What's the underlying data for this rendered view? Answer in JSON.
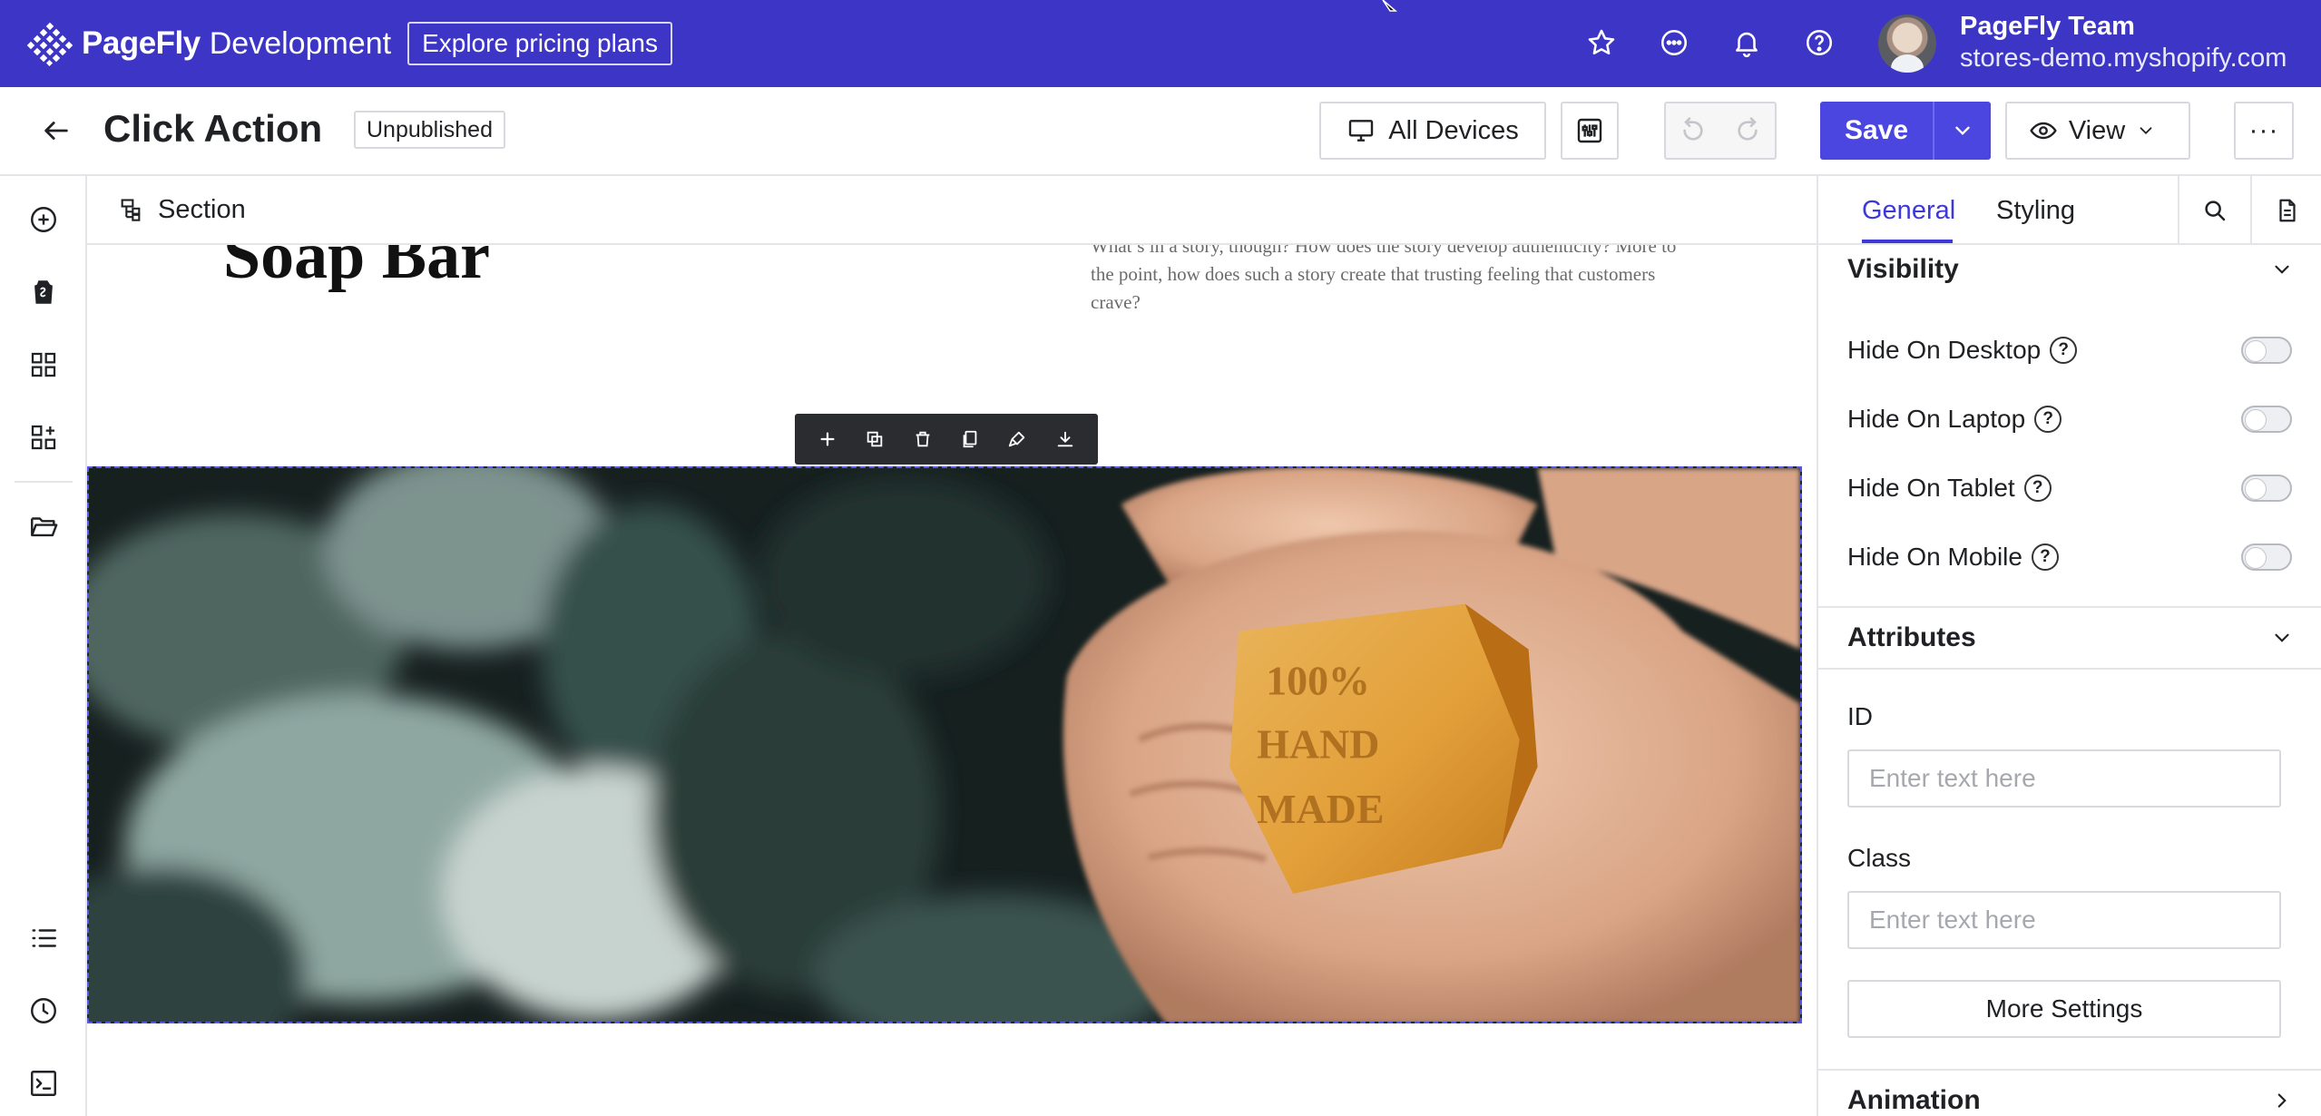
{
  "app": {
    "brand_name": "PageFly",
    "environment": "Development",
    "pricing_link": "Explore pricing plans",
    "team_name": "PageFly Team",
    "store_url": "stores-demo.myshopify.com"
  },
  "toolbar": {
    "page_title": "Click Action",
    "status": "Unpublished",
    "devices_label": "All Devices",
    "save_label": "Save",
    "view_label": "View",
    "more_label": "···"
  },
  "canvas": {
    "breadcrumb": "Section",
    "hero_title": "Soap Bar",
    "hero_copy": "What’s in a story, though? How does the story develop authenticity? More to the point, how does such a story create that trusting feeling that customers crave?",
    "soap_text": "100% HAND MADE"
  },
  "panel": {
    "tabs": [
      {
        "label": "General",
        "active": true
      },
      {
        "label": "Styling",
        "active": false
      }
    ],
    "visibility": {
      "title": "Visibility",
      "items": [
        {
          "label": "Hide On Desktop",
          "enabled": false
        },
        {
          "label": "Hide On Laptop",
          "enabled": false
        },
        {
          "label": "Hide On Tablet",
          "enabled": false
        },
        {
          "label": "Hide On Mobile",
          "enabled": false
        }
      ]
    },
    "attributes": {
      "title": "Attributes",
      "id_label": "ID",
      "id_placeholder": "Enter text here",
      "class_label": "Class",
      "class_placeholder": "Enter text here",
      "more_settings": "More Settings"
    },
    "animation": {
      "title": "Animation"
    }
  },
  "colors": {
    "topbar": "#3c35c5",
    "accent": "#4c46e0",
    "active_tab": "#3e38d8",
    "selection_border": "#5a55e8"
  }
}
